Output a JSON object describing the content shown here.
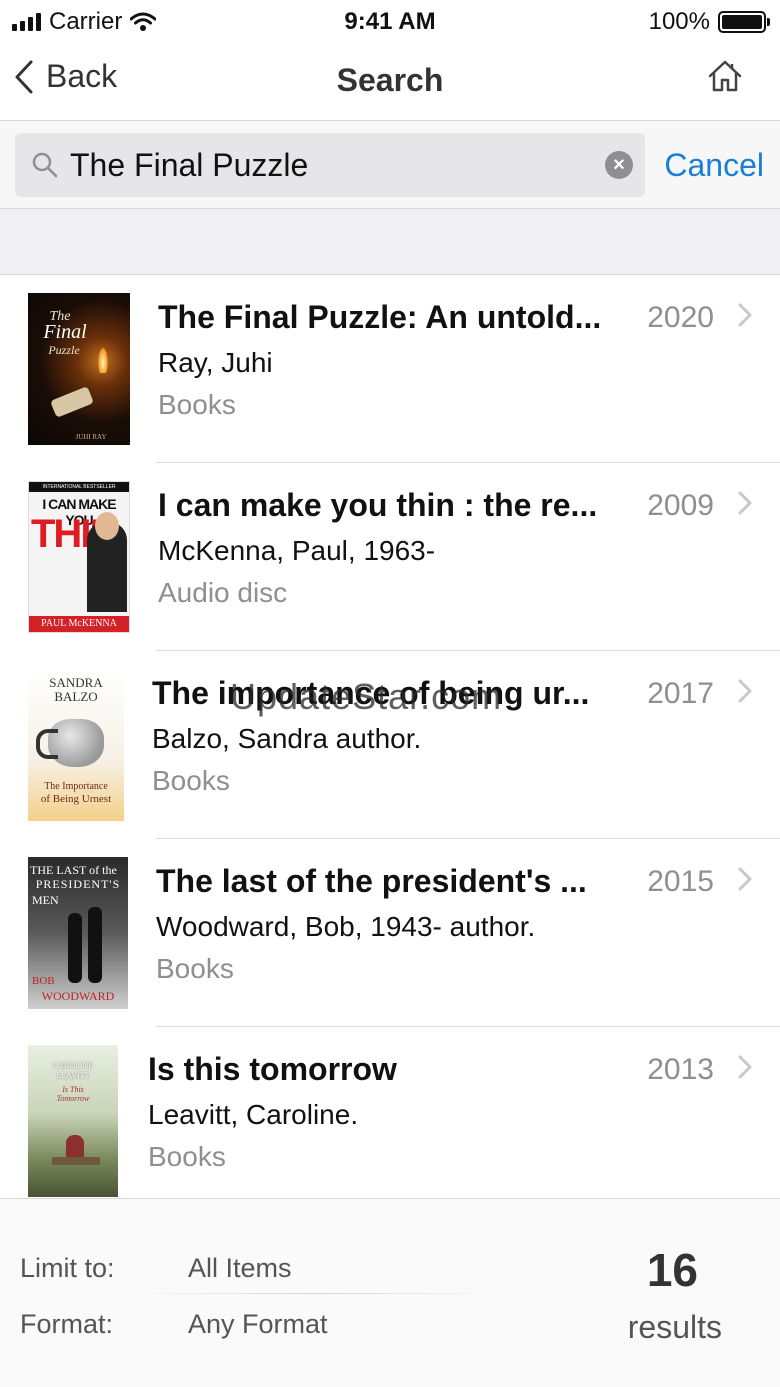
{
  "status_bar": {
    "carrier": "Carrier",
    "time": "9:41 AM",
    "battery": "100%"
  },
  "nav": {
    "back_label": "Back",
    "title": "Search"
  },
  "search": {
    "query": "The Final Puzzle",
    "cancel_label": "Cancel"
  },
  "results": [
    {
      "title": "The Final Puzzle: An untold...",
      "author": "Ray, Juhi",
      "format": "Books",
      "year": "2020",
      "cover_text": [
        "The",
        "Final",
        "Puzzle",
        "JUHI RAY"
      ]
    },
    {
      "title": "I can make you thin : the re...",
      "author": "McKenna, Paul, 1963-",
      "format": "Audio disc",
      "year": "2009",
      "cover_text": [
        "INTERNATIONAL BESTSELLER",
        "I CAN MAKE YOU",
        "THIN",
        "PAUL McKENNA"
      ]
    },
    {
      "title": "The importance of being ur...",
      "author": "Balzo, Sandra author.",
      "format": "Books",
      "year": "2017",
      "cover_text": [
        "SANDRA",
        "BALZO",
        "The Importance",
        "of Being Urnest"
      ]
    },
    {
      "title": "The last of the president's ...",
      "author": "Woodward, Bob, 1943- author.",
      "format": "Books",
      "year": "2015",
      "cover_text": [
        "THE LAST of the",
        "PRESIDENT'S",
        "MEN",
        "BOB",
        "WOODWARD"
      ]
    },
    {
      "title": "Is this tomorrow",
      "author": "Leavitt, Caroline.",
      "format": "Books",
      "year": "2013",
      "cover_text": [
        "CAROLINE",
        "LEAVITT",
        "Is This",
        "Tomorrow"
      ]
    }
  ],
  "watermark": "UpdateStar.com",
  "footer": {
    "limit_label": "Limit to:",
    "limit_value": "All Items",
    "format_label": "Format:",
    "format_value": "Any Format",
    "count": "16",
    "count_label": "results"
  },
  "colors": {
    "accent": "#1a7fd6",
    "secondary_text": "#8e8e93"
  },
  "icons": [
    "signal-icon",
    "wifi-icon",
    "battery-icon",
    "back-chevron-icon",
    "home-icon",
    "search-icon",
    "clear-icon",
    "chevron-right-icon"
  ]
}
